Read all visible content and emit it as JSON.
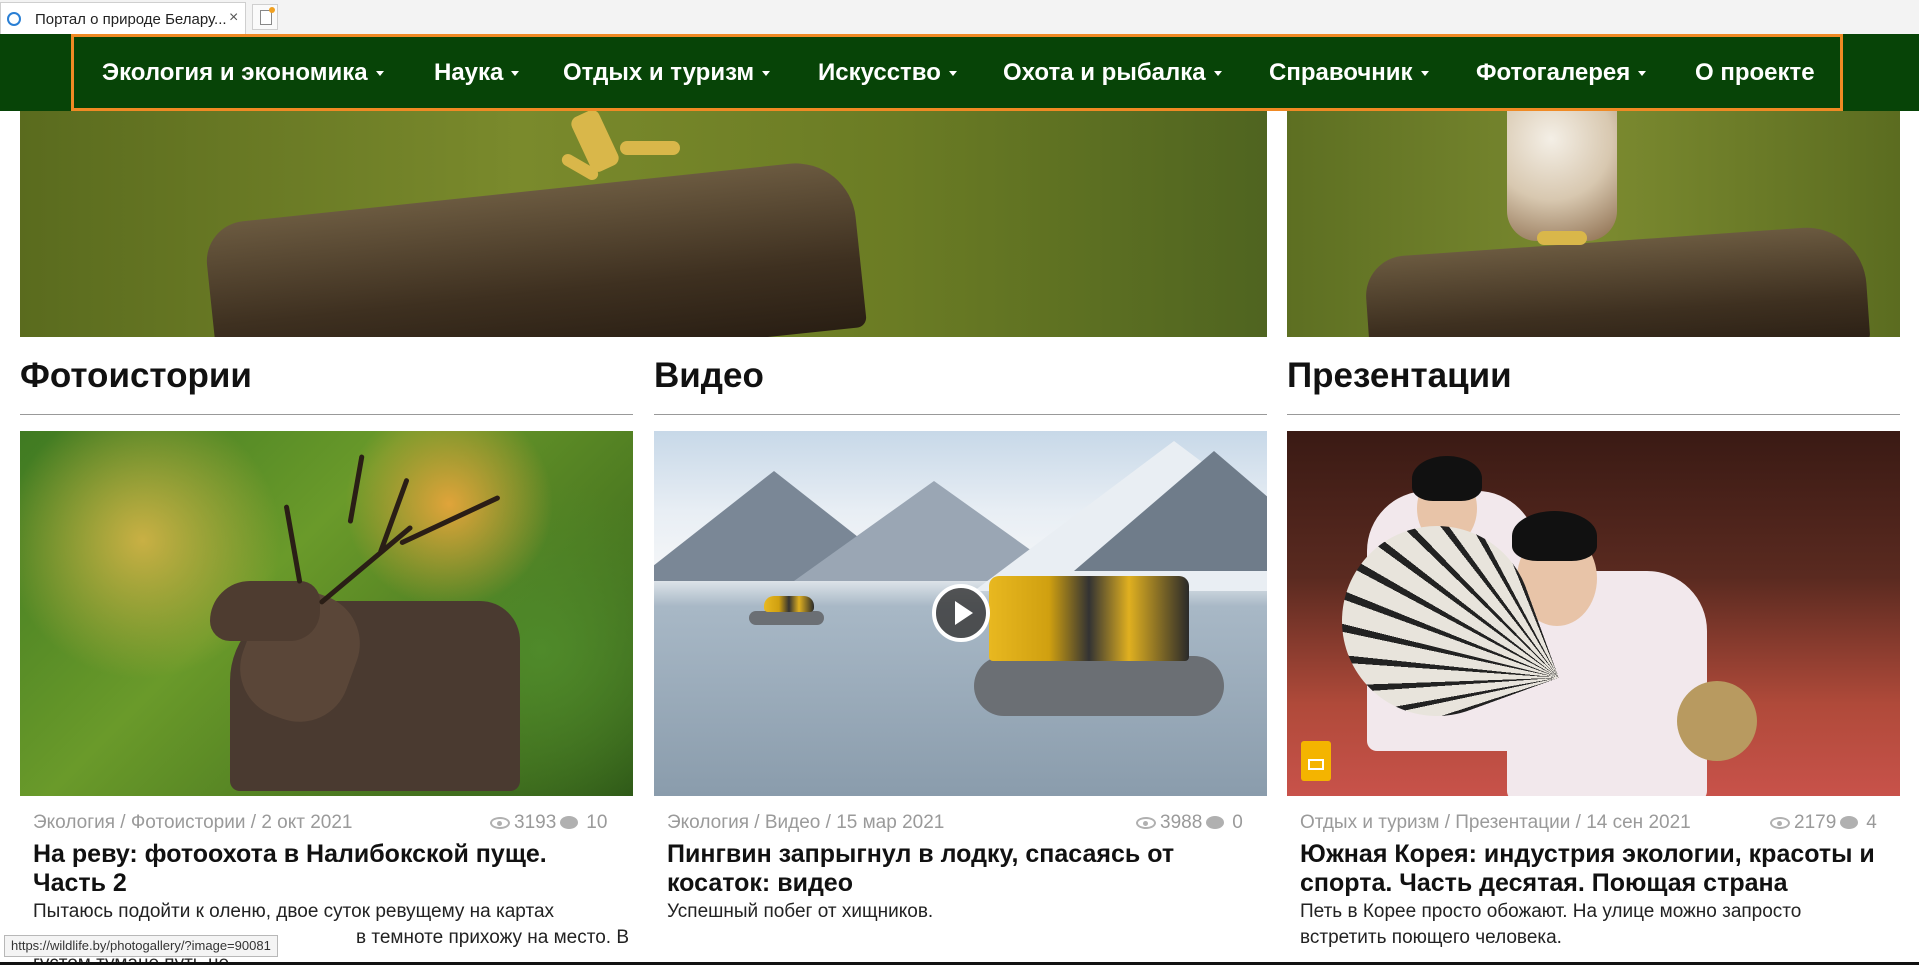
{
  "browser": {
    "tab_title": "Портал о природе Белару...",
    "close_glyph": "×",
    "status_url": "https://wildlife.by/photogallery/?image=90081"
  },
  "nav": {
    "items": [
      {
        "label": "Экология и экономика",
        "dropdown": true
      },
      {
        "label": "Наука",
        "dropdown": true
      },
      {
        "label": "Отдых и туризм",
        "dropdown": true
      },
      {
        "label": "Искусство",
        "dropdown": true
      },
      {
        "label": "Охота и рыбалка",
        "dropdown": true
      },
      {
        "label": "Справочник",
        "dropdown": true
      },
      {
        "label": "Фотогалерея",
        "dropdown": true
      },
      {
        "label": "О проекте",
        "dropdown": false
      }
    ],
    "background": "#074407",
    "highlight_border": "#f08a24"
  },
  "sections": [
    {
      "title": "Фотоистории",
      "card": {
        "meta": "Экология / Фотоистории / 2 окт 2021",
        "views": "3193",
        "comments": "10",
        "title": "На реву: фотоохота в Налибокской пуще. Часть 2",
        "desc": "Пытаюсь подойти к оленю, двое суток ревущему на картах",
        "desc_tail": "в темноте прихожу на место. В",
        "desc_cut": "густом тумане путь не"
      }
    },
    {
      "title": "Видео",
      "card": {
        "meta": "Экология / Видео / 15 мар 2021",
        "views": "3988",
        "comments": "0",
        "title": "Пингвин запрыгнул в лодку, спасаясь от косаток: видео",
        "desc": "Успешный побег от хищников."
      }
    },
    {
      "title": "Презентации",
      "card": {
        "meta": "Отдых и туризм / Презентации / 14 сен 2021",
        "views": "2179",
        "comments": "4",
        "title": "Южная Корея: индустрия экологии, красоты и спорта. Часть десятая. Поющая страна",
        "desc": "Петь в Корее просто обожают. На улице можно запросто встретить поющего человека."
      }
    }
  ]
}
